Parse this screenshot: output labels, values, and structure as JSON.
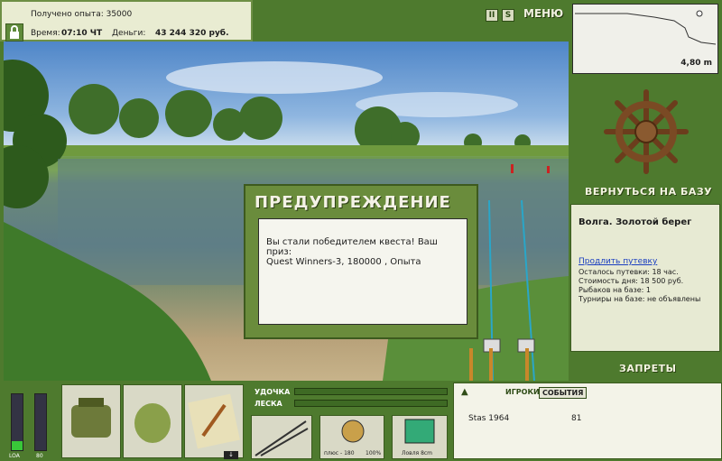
{
  "info": {
    "experience_text": "Получено опыта: 35000",
    "time_label": "Время:",
    "time_value": "07:10 ЧТ",
    "money_label": "Деньги:",
    "money_value": "43 244 320 руб."
  },
  "topbar": {
    "pause_label": "II",
    "s_label": "S",
    "menu_label": "МЕНЮ"
  },
  "depth": {
    "value": "4,80 m"
  },
  "right": {
    "return_label": "ВЕРНУТЬСЯ НА БАЗУ",
    "location_title": "Волга. Золотой берег",
    "extend_link": "Продлить путевку",
    "remaining": "Осталось путевки: 18 час.",
    "cost": "Стоимость дня: 18 500 руб.",
    "fishers": "Рыбаков на базе: 1",
    "tournaments": "Турниры на базе: не объявлены",
    "bans_label": "ЗАПРЕТЫ"
  },
  "dialog": {
    "title": "ПРЕДУПРЕЖДЕНИЕ",
    "message_line1": "Вы стали победителем квеста! Ваш приз:",
    "message_line2": "Quest Winners-3, 180000 , Опыта"
  },
  "bottom": {
    "rod_label": "УДОЧКА",
    "line_label": "ЛЕСКА",
    "meter1_label": "LOA",
    "meter2_label": "80",
    "gear_reel_label": "плюс - 180",
    "gear_pct_label": "100%",
    "gear_bait_label": "Ловля 8cm"
  },
  "events": {
    "players_tab": "ИГРОКИ",
    "events_tab": "СОБЫТИЯ",
    "rows": [
      {
        "name": "Stas 1964",
        "value": "81"
      }
    ]
  },
  "colors": {
    "panel_green": "#4e7a2e",
    "dialog_green": "#6a8c3c",
    "panel_bg": "#e7ead3"
  }
}
